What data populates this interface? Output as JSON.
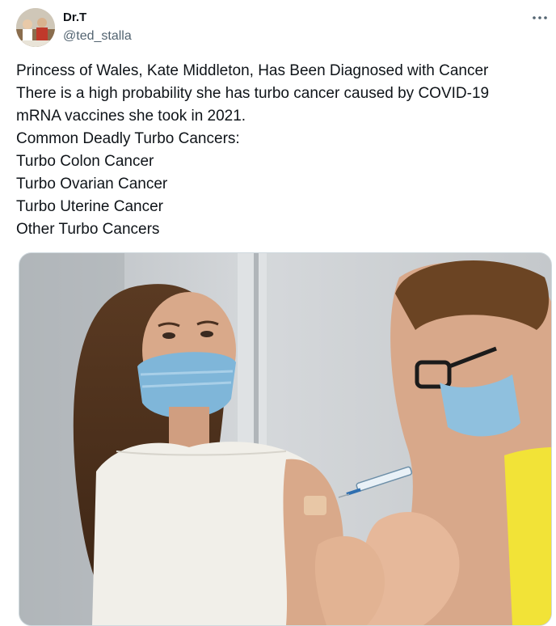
{
  "author": {
    "name": "Dr.T",
    "handle": "@ted_stalla",
    "avatar_icon": "profile-avatar"
  },
  "menu": {
    "more_icon": "more-dots-icon"
  },
  "tweet": {
    "lines": [
      "Princess of Wales, Kate Middleton, Has Been Diagnosed with Cancer",
      "There is a high probability she has turbo cancer caused by COVID-19",
      "mRNA vaccines she took in 2021.",
      "Common Deadly Turbo Cancers:",
      "Turbo Colon Cancer",
      "Turbo Ovarian Cancer",
      "Turbo Uterine Cancer",
      "Other Turbo Cancers"
    ]
  },
  "colors": {
    "text_primary": "#0f1419",
    "text_secondary": "#536471",
    "border": "#cfd9de",
    "mask_blue": "#7fb6d9",
    "vest_yellow": "#f2e337"
  }
}
